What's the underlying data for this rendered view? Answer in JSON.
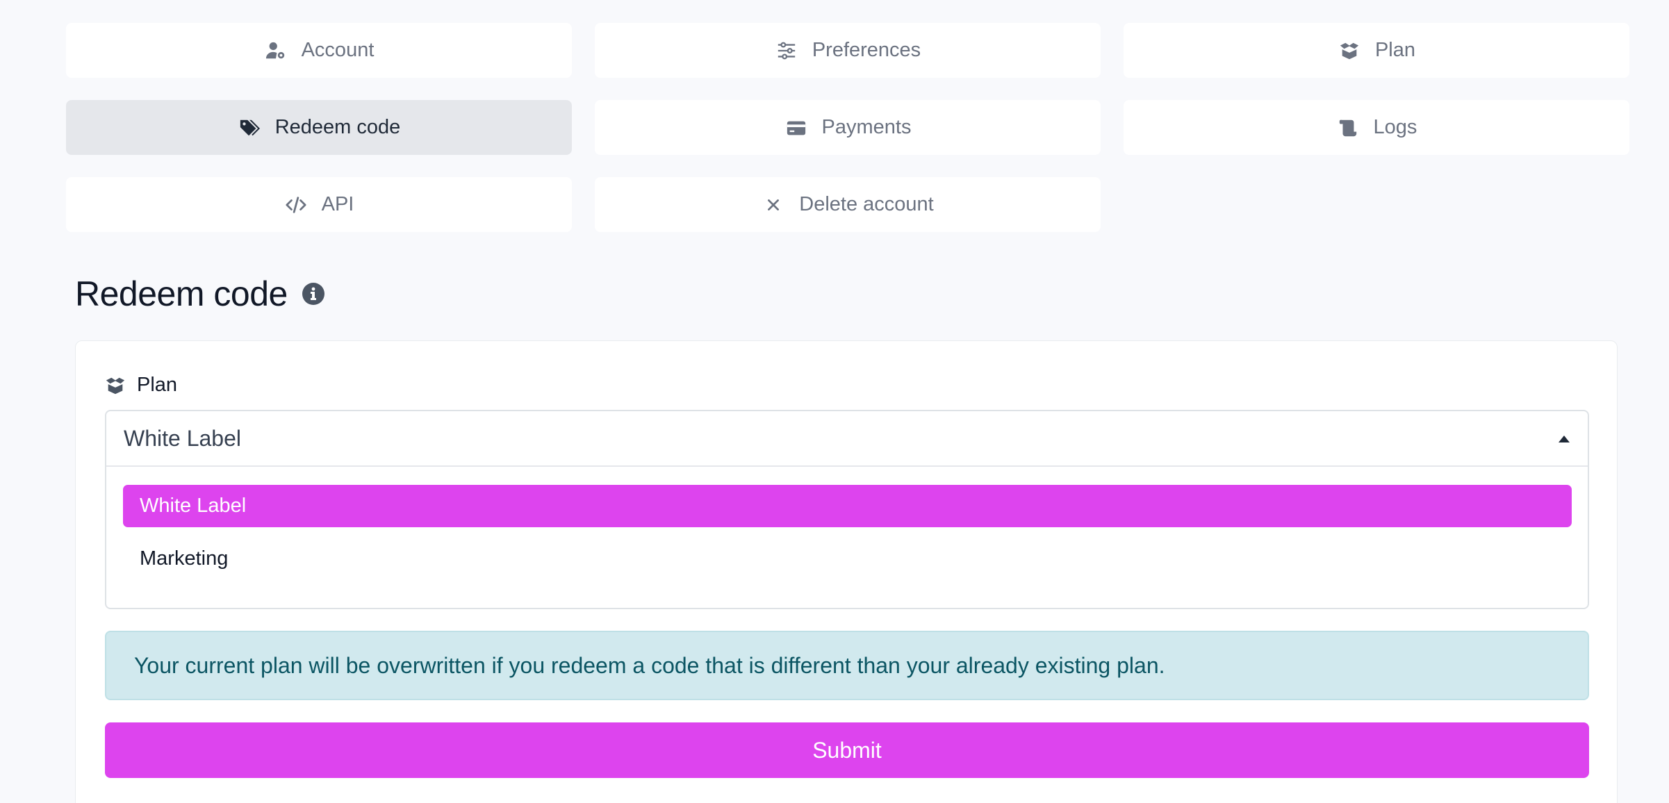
{
  "nav": {
    "items": [
      {
        "label": "Account",
        "icon": "user-gear-icon",
        "active": false
      },
      {
        "label": "Preferences",
        "icon": "sliders-icon",
        "active": false
      },
      {
        "label": "Plan",
        "icon": "box-open-icon",
        "active": false
      },
      {
        "label": "Redeem code",
        "icon": "tags-icon",
        "active": true
      },
      {
        "label": "Payments",
        "icon": "credit-card-icon",
        "active": false
      },
      {
        "label": "Logs",
        "icon": "scroll-icon",
        "active": false
      },
      {
        "label": "API",
        "icon": "code-icon",
        "active": false
      },
      {
        "label": "Delete account",
        "icon": "close-icon",
        "active": false
      }
    ]
  },
  "page": {
    "title": "Redeem code",
    "title_icon": "info-icon"
  },
  "form": {
    "plan_label": "Plan",
    "plan_label_icon": "box-open-icon",
    "plan_selected": "White Label",
    "plan_options": [
      "White Label",
      "Marketing"
    ],
    "notice": "Your current plan will be overwritten if you redeem a code that is different than your already existing plan.",
    "submit_label": "Submit"
  },
  "colors": {
    "accent": "#dd44ee",
    "notice_bg": "#d1e9ee",
    "notice_text": "#0b5563",
    "active_tab_bg": "#e5e7eb"
  }
}
